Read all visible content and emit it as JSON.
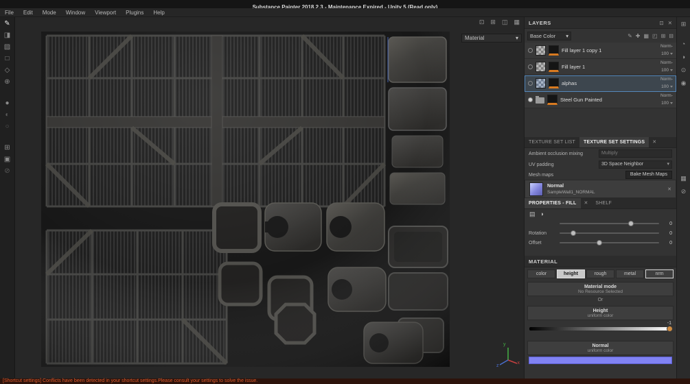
{
  "window": {
    "title": "Substance Painter 2018.2.3 - Maintenance Expired - Unity 5 (Read only)"
  },
  "menu": {
    "items": [
      "File",
      "Edit",
      "Mode",
      "Window",
      "Viewport",
      "Plugins",
      "Help"
    ]
  },
  "icons": {
    "arrow_down": "▾",
    "popout": "⊡",
    "close": "✕"
  },
  "left_toolbar": [
    {
      "name": "paint-tool",
      "glyph": "✎"
    },
    {
      "name": "eraser-tool",
      "glyph": "◨"
    },
    {
      "name": "projection-tool",
      "glyph": "▨"
    },
    {
      "name": "polygon-fill-tool",
      "glyph": "□"
    },
    {
      "name": "smudge-tool",
      "glyph": "◇"
    },
    {
      "name": "clone-tool",
      "glyph": "⊕"
    },
    {
      "name": "material-sphere-toggle",
      "glyph": "●"
    },
    {
      "name": "half-sphere-toggle",
      "glyph": "◐"
    },
    {
      "name": "outline-sphere-toggle",
      "glyph": "○"
    },
    {
      "name": "resources-icon",
      "glyph": "⊞"
    },
    {
      "name": "display-mode-icon",
      "glyph": "▣"
    },
    {
      "name": "disabled-tool-icon",
      "glyph": "⊘"
    }
  ],
  "viewport": {
    "material_label": "Material",
    "toolbar_icons": [
      {
        "name": "viewport-display-icon",
        "glyph": "⊡"
      },
      {
        "name": "viewport-envmap-icon",
        "glyph": "⊞"
      },
      {
        "name": "viewport-camera-icon",
        "glyph": "◫"
      },
      {
        "name": "viewport-grid-icon",
        "glyph": "▦"
      }
    ],
    "gizmo": {
      "x": "x",
      "y": "y",
      "z": "z"
    }
  },
  "layers": {
    "header": "LAYERS",
    "channel": "Base Color",
    "control_icons": [
      {
        "name": "add-effect-icon",
        "glyph": "✎"
      },
      {
        "name": "add-mask-icon",
        "glyph": "✚"
      },
      {
        "name": "add-fill-layer-icon",
        "glyph": "▦"
      },
      {
        "name": "add-folder-icon",
        "glyph": "◰"
      },
      {
        "name": "add-layer-icon",
        "glyph": "⊞"
      },
      {
        "name": "delete-layer-icon",
        "glyph": "⊟"
      }
    ],
    "items": [
      {
        "name": "Fill layer 1 copy 1",
        "blend": "Norm-",
        "opacity": "100"
      },
      {
        "name": "Fill layer 1",
        "blend": "Norm-",
        "opacity": "100"
      },
      {
        "name": "alphas",
        "blend": "Norm-",
        "opacity": "100"
      },
      {
        "name": "Steel Gun Painted",
        "blend": "Norm-",
        "opacity": "100"
      }
    ]
  },
  "texture_set": {
    "tabs": [
      {
        "label": "TEXTURE SET LIST"
      },
      {
        "label": "TEXTURE SET SETTINGS"
      }
    ],
    "ao_label": "Ambient occlusion mixing",
    "ao_value": "Multiply",
    "uv_label": "UV padding",
    "uv_value": "3D Space Neighbor",
    "mesh_maps_label": "Mesh maps",
    "bake_button": "Bake Mesh Maps",
    "normal_map": {
      "channel": "Normal",
      "file": "SampleWall1_NORMAL"
    }
  },
  "properties": {
    "tab": "PROPERTIES - FILL",
    "shelf_tab": "SHELF",
    "icon_row": [
      {
        "name": "uv-transform-icon",
        "glyph": "▤"
      },
      {
        "name": "projection-mode-icon",
        "glyph": "◑"
      }
    ],
    "sliders": [
      {
        "label": "",
        "value": "0"
      },
      {
        "label": "Rotation",
        "value": "0"
      },
      {
        "label": "Offset",
        "value": "0"
      }
    ]
  },
  "material": {
    "header": "MATERIAL",
    "channels": [
      {
        "label": "color"
      },
      {
        "label": "height"
      },
      {
        "label": "rough"
      },
      {
        "label": "metal"
      },
      {
        "label": "nrm"
      }
    ],
    "mode_title": "Material mode",
    "mode_subtitle": "No Resource Selected",
    "or_label": "Or",
    "height_title": "Height",
    "height_subtitle": "uniform color",
    "height_value": "-1",
    "normal_title": "Normal",
    "normal_subtitle": "uniform color",
    "normal_color": "#8183f4"
  },
  "right_strip": [
    {
      "name": "dock-panel-icon",
      "glyph": "⊞"
    },
    {
      "name": "history-icon",
      "glyph": "◔"
    },
    {
      "name": "display-settings-icon",
      "glyph": "◑"
    },
    {
      "name": "shader-settings-icon",
      "glyph": "⊙"
    },
    {
      "name": "camera-settings-icon",
      "glyph": "◉"
    },
    {
      "name": "texture-view-icon",
      "glyph": "▦"
    },
    {
      "name": "help-icon",
      "glyph": "⊘"
    }
  ],
  "colors": {
    "accent_orange": "#d87a20",
    "selection_blue": "#5588bb",
    "normal_map_blue": "#8183f4",
    "warning_orange": "#e05c2e"
  },
  "status": {
    "warning": "[Shortcut settings] Conflicts have been detected in your shortcut settings.Please consult your settings to solve the issue."
  }
}
